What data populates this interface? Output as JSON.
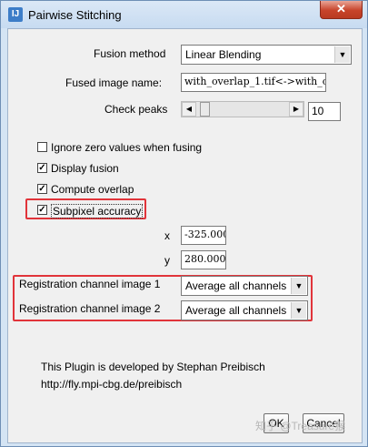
{
  "window": {
    "title": "Pairwise Stitching",
    "close_glyph": "✕",
    "app_glyph": "IJ"
  },
  "fusion": {
    "label": "Fusion method",
    "value": "Linear Blending"
  },
  "fused_name": {
    "label": "Fused image name:",
    "value": "with_overlap_1.tif<->with_o"
  },
  "check_peaks": {
    "label": "Check peaks",
    "value": "10"
  },
  "options": {
    "ignore_zero": {
      "label": "Ignore zero values when fusing",
      "checked": false
    },
    "display_fusion": {
      "label": "Display fusion",
      "checked": true
    },
    "compute_overlap": {
      "label": "Compute overlap",
      "checked": true
    },
    "subpixel": {
      "label": "Subpixel accuracy",
      "checked": true
    }
  },
  "coords": {
    "x_label": "x",
    "x_value": "-325.000",
    "y_label": "y",
    "y_value": "280.000"
  },
  "registration": {
    "ch1_label": "Registration channel image 1",
    "ch1_value": "Average all channels",
    "ch2_label": "Registration channel image 2",
    "ch2_value": "Average all channels"
  },
  "info": {
    "line1": "This Plugin is developed by Stephan Preibisch",
    "line2": "http://fly.mpi-cbg.de/preibisch"
  },
  "buttons": {
    "ok": "OK",
    "cancel": "Cancel"
  },
  "watermark": "知乎 @Treasure猴",
  "colors": {
    "highlight": "#e1343a"
  }
}
